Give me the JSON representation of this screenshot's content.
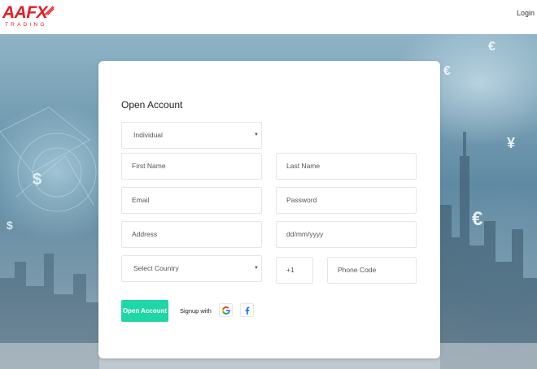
{
  "header": {
    "logo_text": "AAFX",
    "logo_subtext": "TRADING",
    "login_label": "Login"
  },
  "form": {
    "title": "Open Account",
    "account_type": {
      "value": "Individual"
    },
    "first_name": {
      "placeholder": "First Name"
    },
    "last_name": {
      "placeholder": "Last Name"
    },
    "email": {
      "placeholder": "Email"
    },
    "password": {
      "placeholder": "Password"
    },
    "address": {
      "placeholder": "Address"
    },
    "dob": {
      "placeholder": "dd/mm/yyyy"
    },
    "country": {
      "value": "Select Country"
    },
    "country_code": {
      "value": "+1"
    },
    "phone": {
      "placeholder": "Phone Code"
    },
    "submit_label": "Open Account",
    "signup_with_label": "Signup with"
  },
  "icons": {
    "dropdown_caret": "▼",
    "google": "google-icon",
    "facebook": "facebook-icon"
  },
  "colors": {
    "brand_red": "#e31e24",
    "primary_button": "#1fd6a6",
    "facebook_blue": "#1877f2"
  }
}
